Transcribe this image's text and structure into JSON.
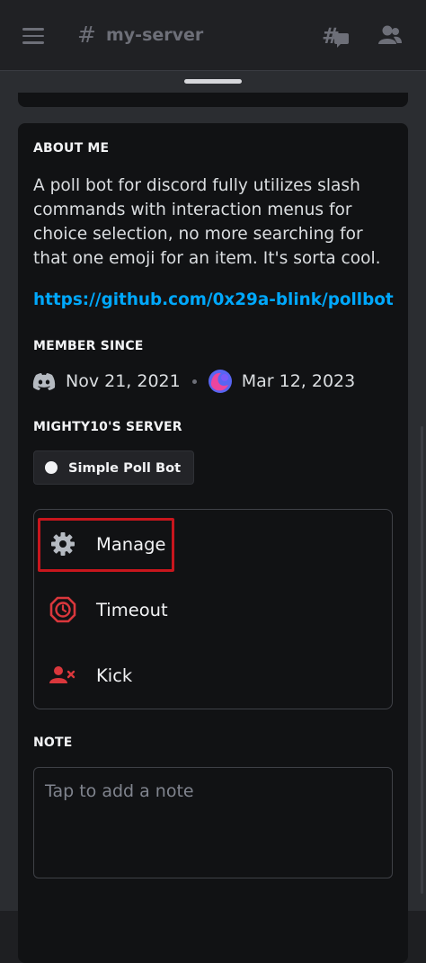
{
  "header": {
    "hash": "#",
    "channel_name": "my-server"
  },
  "about_me": {
    "title": "ABOUT ME",
    "text": "A poll bot for discord fully utilizes slash commands with interaction menus for choice selection, no more searching for that one emoji for an item. It's sorta cool.",
    "link": "https://github.com/0x29a-blink/pollbot"
  },
  "member_since": {
    "title": "MEMBER SINCE",
    "discord_date": "Nov 21, 2021",
    "server_date": "Mar 12, 2023"
  },
  "server_section": {
    "title": "MIGHTY10'S SERVER",
    "role_chip": "Simple Poll Bot"
  },
  "actions": {
    "items": [
      {
        "label": "Manage",
        "icon": "gear-icon"
      },
      {
        "label": "Timeout",
        "icon": "timeout-icon"
      },
      {
        "label": "Kick",
        "icon": "kick-user-icon"
      }
    ]
  },
  "note": {
    "title": "NOTE",
    "placeholder": "Tap to add a note"
  },
  "colors": {
    "link": "#00a8fc",
    "danger": "#da373c",
    "highlight": "#c8161d"
  }
}
